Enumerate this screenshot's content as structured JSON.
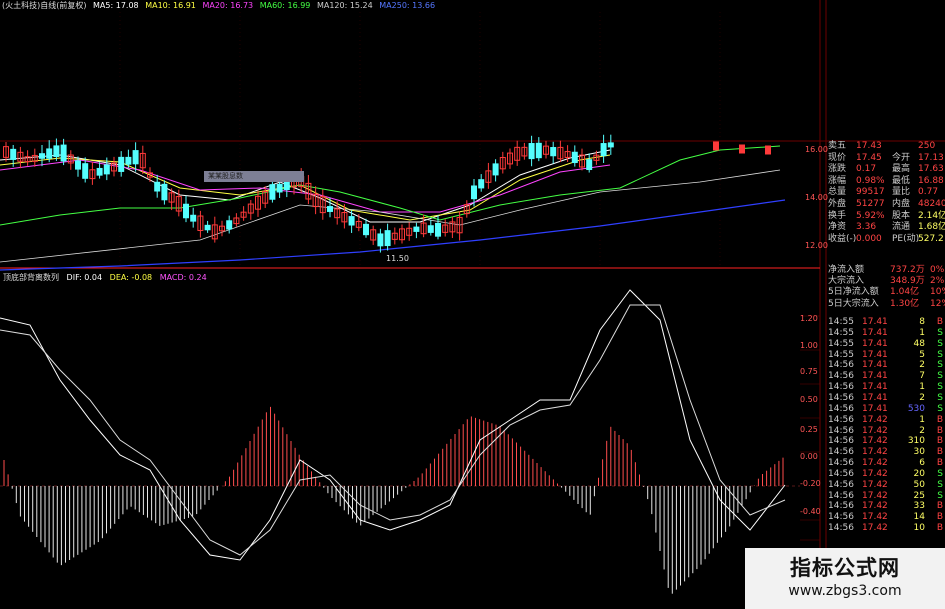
{
  "top_legend": {
    "indicator_name": "(火土科技)自线(前复权)",
    "ma_items": [
      {
        "label": "MA5: 17.08",
        "color": "#ffffff"
      },
      {
        "label": "MA10: 16.91",
        "color": "#ffff44"
      },
      {
        "label": "MA20: 16.73",
        "color": "#ff44ff"
      },
      {
        "label": "MA60: 16.99",
        "color": "#44ff44"
      },
      {
        "label": "MA120: 15.24",
        "color": "#cccccc"
      },
      {
        "label": "MA250: 13.66",
        "color": "#5577ff"
      }
    ]
  },
  "price_axis": {
    "labels": [
      "16.00",
      "14.00",
      "12.00"
    ]
  },
  "annotations": {
    "low_label": "11.50",
    "callout_text": "某某股息数"
  },
  "macd_legend": {
    "name": "顶底部背离数列",
    "dif": "DIF: 0.04",
    "dea": "DEA: -0.08",
    "macd": "MACD: 0.24"
  },
  "macd_axis": {
    "labels": [
      "1.20",
      "1.00",
      "0.75",
      "0.50",
      "0.25",
      "0.00",
      "-0.20",
      "-0.40"
    ]
  },
  "quote_panel": {
    "rows": [
      {
        "label": "卖五",
        "value": "17.43",
        "label2": "",
        "value2": "250"
      },
      {
        "label": "现价",
        "value": "17.45",
        "label2": "今开",
        "value2": "17.13"
      },
      {
        "label": "涨跌",
        "value": "0.17",
        "label2": "最高",
        "value2": "17.63"
      },
      {
        "label": "涨幅",
        "value": "0.98%",
        "label2": "最低",
        "value2": "16.88"
      },
      {
        "label": "总量",
        "value": "99517",
        "label2": "量比",
        "value2": "0.77"
      },
      {
        "label": "外盘",
        "value": "51277",
        "label2": "内盘",
        "value2": "48240"
      },
      {
        "label": "换手",
        "value": "5.92%",
        "label2": "股本",
        "value2": "2.14亿"
      },
      {
        "label": "净资",
        "value": "3.36",
        "label2": "流通",
        "value2": "1.68亿"
      },
      {
        "label": "收益(-)",
        "value": "0.000",
        "label2": "PE(动)",
        "value2": "527.2"
      }
    ],
    "flow_rows": [
      {
        "label": "净流入额",
        "value": "737.2万",
        "pct": "0%"
      },
      {
        "label": "大宗流入",
        "value": "348.9万",
        "pct": "2%"
      },
      {
        "label": "5日净流入额",
        "value": "1.04亿",
        "pct": "10%"
      },
      {
        "label": "5日大宗流入",
        "value": "1.30亿",
        "pct": "12%"
      }
    ]
  },
  "trades": [
    {
      "time": "14:55",
      "price": "17.41",
      "vol": "8",
      "side": "B"
    },
    {
      "time": "14:55",
      "price": "17.41",
      "vol": "1",
      "side": "S"
    },
    {
      "time": "14:55",
      "price": "17.41",
      "vol": "48",
      "side": "S"
    },
    {
      "time": "14:55",
      "price": "17.41",
      "vol": "5",
      "side": "S"
    },
    {
      "time": "14:56",
      "price": "17.41",
      "vol": "2",
      "side": "S"
    },
    {
      "time": "14:56",
      "price": "17.41",
      "vol": "7",
      "side": "S"
    },
    {
      "time": "14:56",
      "price": "17.41",
      "vol": "1",
      "side": "S"
    },
    {
      "time": "14:56",
      "price": "17.41",
      "vol": "2",
      "side": "S"
    },
    {
      "time": "14:56",
      "price": "17.41",
      "vol": "530",
      "side": "S"
    },
    {
      "time": "14:56",
      "price": "17.42",
      "vol": "1",
      "side": "B"
    },
    {
      "time": "14:56",
      "price": "17.42",
      "vol": "2",
      "side": "B"
    },
    {
      "time": "14:56",
      "price": "17.42",
      "vol": "310",
      "side": "B"
    },
    {
      "time": "14:56",
      "price": "17.42",
      "vol": "30",
      "side": "B"
    },
    {
      "time": "14:56",
      "price": "17.42",
      "vol": "6",
      "side": "B"
    },
    {
      "time": "14:56",
      "price": "17.42",
      "vol": "20",
      "side": "S"
    },
    {
      "time": "14:56",
      "price": "17.42",
      "vol": "50",
      "side": "S"
    },
    {
      "time": "14:56",
      "price": "17.42",
      "vol": "25",
      "side": "S"
    },
    {
      "time": "14:56",
      "price": "17.42",
      "vol": "33",
      "side": "B"
    },
    {
      "time": "14:56",
      "price": "17.42",
      "vol": "14",
      "side": "B"
    },
    {
      "time": "14:56",
      "price": "17.42",
      "vol": "10",
      "side": "B"
    }
  ],
  "watermark": {
    "title": "指标公式网",
    "url": "www.zbgs3.com"
  },
  "colors": {
    "up": "#ff3a3a",
    "down": "#55ffff",
    "ma250": "#2f3fff",
    "ma60": "#44ff44",
    "dif": "#ffffff",
    "dea": "#dddddd",
    "grid": "#6b0000"
  }
}
